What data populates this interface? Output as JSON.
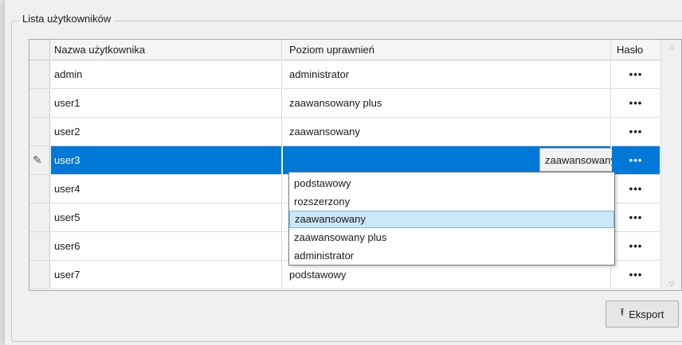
{
  "groupbox": {
    "title": "Lista użytkowników"
  },
  "table": {
    "columns": [
      "Nazwa użytkownika",
      "Poziom uprawnień",
      "Hasło"
    ],
    "rows": [
      {
        "name": "admin",
        "level": "administrator",
        "password": "•••"
      },
      {
        "name": "user1",
        "level": "zaawansowany plus",
        "password": "•••"
      },
      {
        "name": "user2",
        "level": "zaawansowany",
        "password": "•••"
      },
      {
        "name": "user3",
        "level": "zaawansowany",
        "password": "•••",
        "selected": true
      },
      {
        "name": "user4",
        "level": "",
        "password": "•••"
      },
      {
        "name": "user5",
        "level": "",
        "password": "•••"
      },
      {
        "name": "user6",
        "level": "",
        "password": "•••"
      },
      {
        "name": "user7",
        "level": "podstawowy",
        "password": "•••"
      }
    ]
  },
  "dropdown": {
    "options": [
      "podstawowy",
      "rozszerzony",
      "zaawansowany",
      "zaawansowany plus",
      "administrator"
    ],
    "highlighted": "zaawansowany"
  },
  "export_button": {
    "label": "Eksport",
    "icon": "export-icon"
  },
  "colors": {
    "selection": "#0078d7",
    "dropdown_highlight": "#cce8f7"
  }
}
